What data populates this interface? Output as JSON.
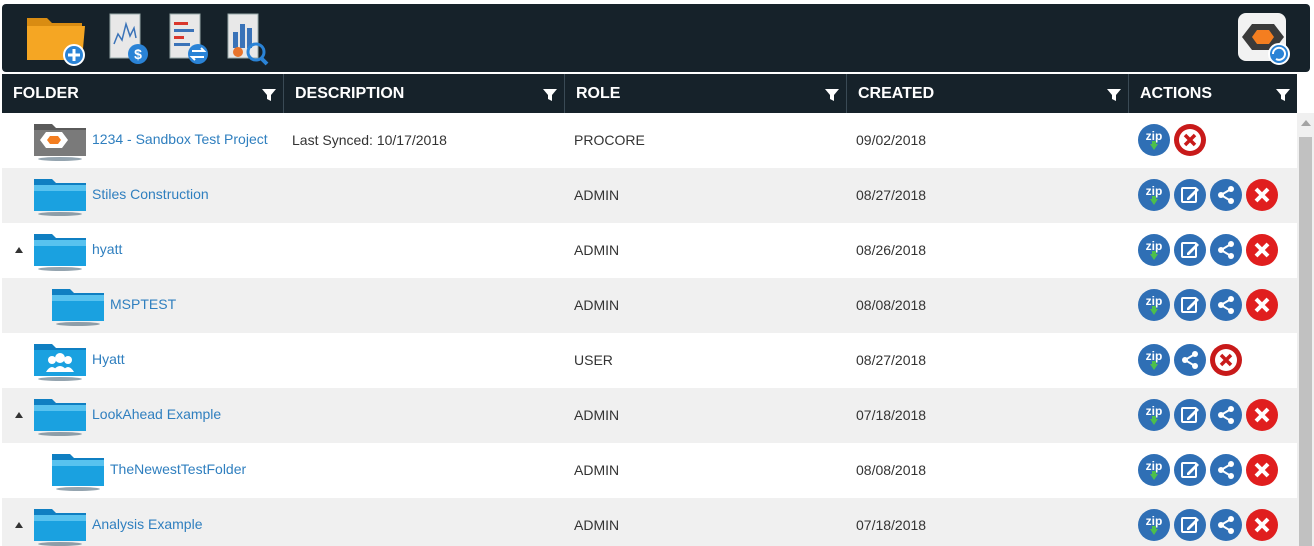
{
  "toolbar": {
    "buttons": [
      {
        "icon": "add-folder-icon"
      },
      {
        "icon": "cost-report-icon"
      },
      {
        "icon": "compare-report-icon"
      },
      {
        "icon": "analysis-report-icon"
      },
      {
        "icon": "procore-sync-icon"
      }
    ]
  },
  "table": {
    "headers": {
      "folder": "FOLDER",
      "description": "DESCRIPTION",
      "role": "ROLE",
      "created": "CREATED",
      "actions": "ACTIONS"
    },
    "rows": [
      {
        "name": "1234 - Sandbox Test Project",
        "description": "Last Synced: 10/17/2018",
        "role": "PROCORE",
        "created": "09/02/2018",
        "icon": "procore-folder-icon",
        "expandable": false,
        "level": 0,
        "actions": [
          "zip-download",
          "delete-outline"
        ]
      },
      {
        "name": "Stiles Construction",
        "description": "",
        "role": "ADMIN",
        "created": "08/27/2018",
        "icon": "folder-icon",
        "expandable": false,
        "level": 0,
        "actions": [
          "zip-download",
          "edit",
          "share",
          "delete"
        ]
      },
      {
        "name": "hyatt",
        "description": "",
        "role": "ADMIN",
        "created": "08/26/2018",
        "icon": "folder-icon",
        "expandable": true,
        "level": 0,
        "actions": [
          "zip-download",
          "edit",
          "share",
          "delete"
        ]
      },
      {
        "name": "MSPTEST",
        "description": "",
        "role": "ADMIN",
        "created": "08/08/2018",
        "icon": "folder-icon",
        "expandable": false,
        "level": 1,
        "actions": [
          "zip-download",
          "edit",
          "share",
          "delete"
        ]
      },
      {
        "name": "Hyatt",
        "description": "",
        "role": "USER",
        "created": "08/27/2018",
        "icon": "shared-folder-icon",
        "expandable": false,
        "level": 0,
        "actions": [
          "zip-download",
          "share",
          "delete-outline"
        ]
      },
      {
        "name": "LookAhead Example",
        "description": "",
        "role": "ADMIN",
        "created": "07/18/2018",
        "icon": "folder-icon",
        "expandable": true,
        "level": 0,
        "actions": [
          "zip-download",
          "edit",
          "share",
          "delete"
        ]
      },
      {
        "name": "TheNewestTestFolder",
        "description": "",
        "role": "ADMIN",
        "created": "08/08/2018",
        "icon": "folder-icon",
        "expandable": false,
        "level": 1,
        "actions": [
          "zip-download",
          "edit",
          "share",
          "delete"
        ]
      },
      {
        "name": "Analysis Example",
        "description": "",
        "role": "ADMIN",
        "created": "07/18/2018",
        "icon": "folder-icon",
        "expandable": true,
        "level": 0,
        "actions": [
          "zip-download",
          "edit",
          "share",
          "delete"
        ]
      }
    ]
  },
  "colors": {
    "header_bg": "#16222a",
    "link": "#2f7fbf",
    "alt_row": "#f0f0f0",
    "action_blue": "#2f6fb5",
    "delete_red": "#e01e1e"
  }
}
